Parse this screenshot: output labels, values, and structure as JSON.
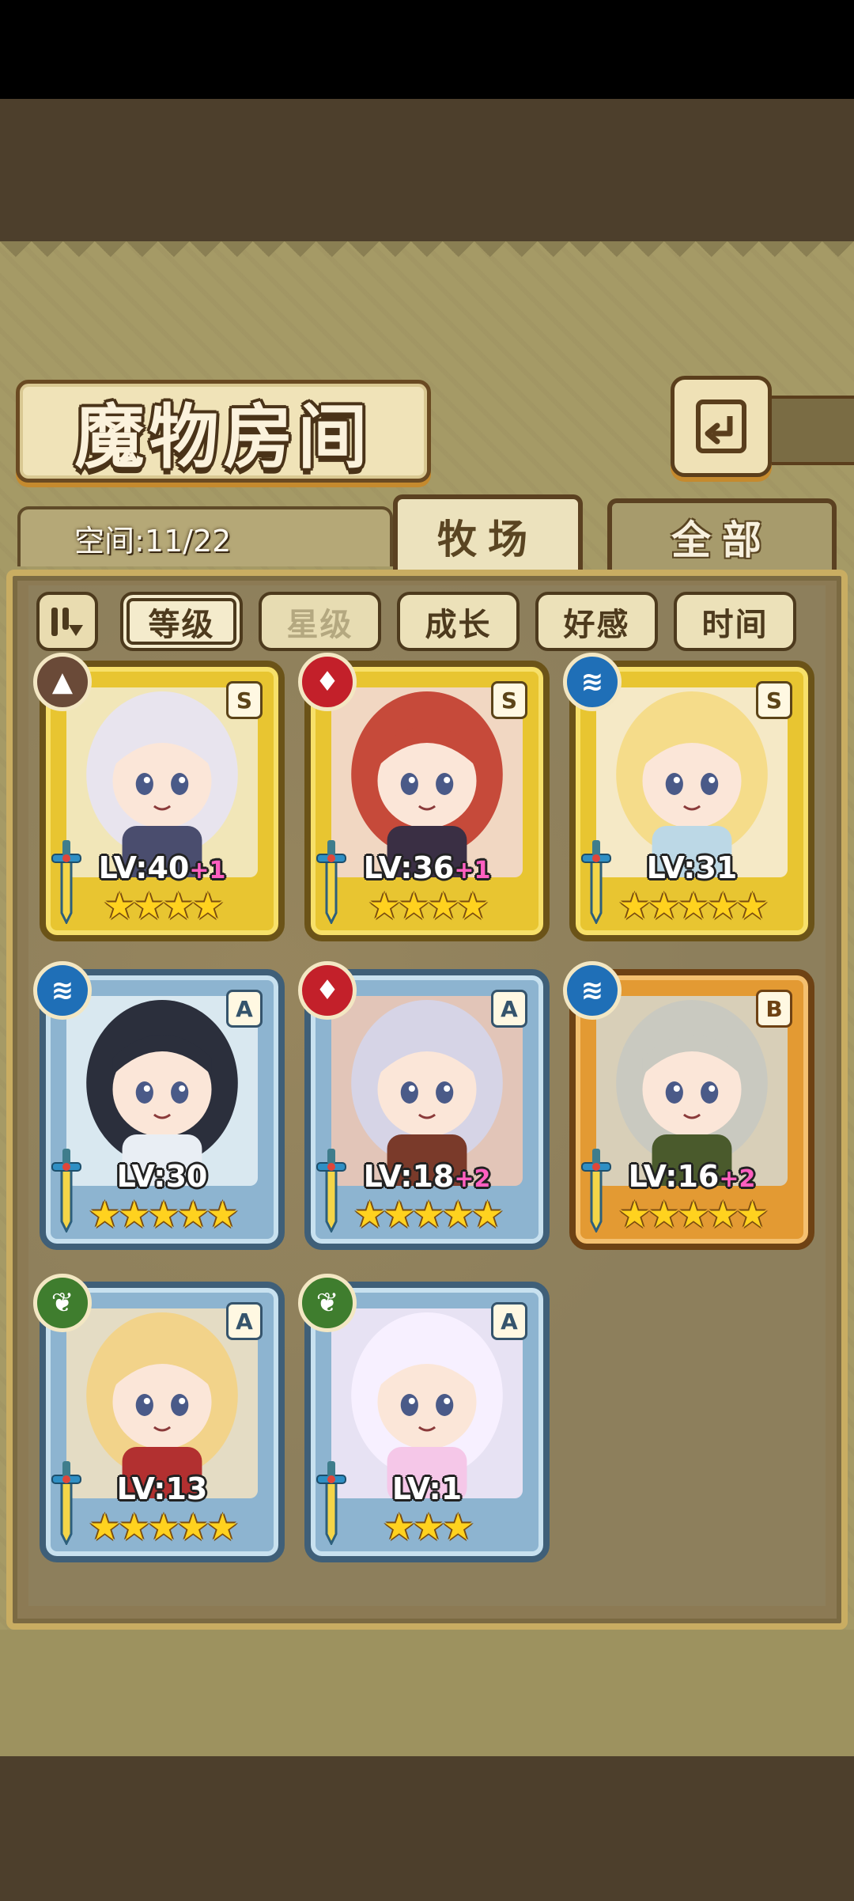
{
  "header": {
    "title": "魔物房间",
    "back_icon": "return-arrow-icon"
  },
  "tabs": {
    "space_label": "空间:11/22",
    "ranch": "牧场",
    "all": "全部"
  },
  "filters": {
    "sort_icon": "sort-order-icon",
    "items": [
      {
        "label": "等级",
        "state": "selected"
      },
      {
        "label": "星级",
        "state": "dim"
      },
      {
        "label": "成长",
        "state": "normal"
      },
      {
        "label": "好感",
        "state": "normal"
      },
      {
        "label": "时间",
        "state": "normal"
      }
    ]
  },
  "monsters": [
    {
      "level": "LV:40",
      "plus": "+1",
      "grade": "S",
      "element": "earth",
      "stars": 4,
      "frame_color": "#e8c531"
    },
    {
      "level": "LV:36",
      "plus": "+1",
      "grade": "S",
      "element": "fire",
      "stars": 4,
      "frame_color": "#e8c531"
    },
    {
      "level": "LV:31",
      "plus": "",
      "grade": "S",
      "element": "water",
      "stars": 5,
      "frame_color": "#e8c531"
    },
    {
      "level": "LV:30",
      "plus": "",
      "grade": "A",
      "element": "water",
      "stars": 5,
      "frame_color": "#8db4d0"
    },
    {
      "level": "LV:18",
      "plus": "+2",
      "grade": "A",
      "element": "fire",
      "stars": 5,
      "frame_color": "#8db4d0"
    },
    {
      "level": "LV:16",
      "plus": "+2",
      "grade": "B",
      "element": "water",
      "stars": 5,
      "frame_color": "#e39a33"
    },
    {
      "level": "LV:13",
      "plus": "",
      "grade": "A",
      "element": "wood",
      "stars": 5,
      "frame_color": "#8db4d0"
    },
    {
      "level": "LV:1",
      "plus": "",
      "grade": "A",
      "element": "wood",
      "stars": 3,
      "frame_color": "#8db4d0"
    }
  ]
}
